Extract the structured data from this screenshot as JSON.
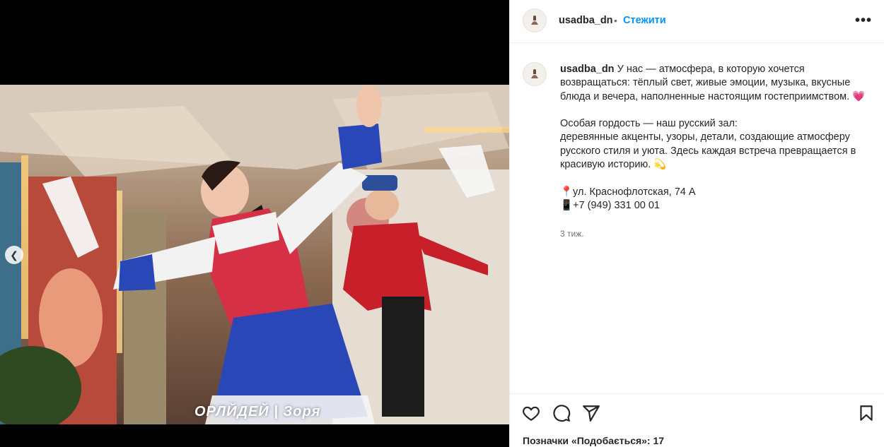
{
  "media": {
    "watermark": "ОРЛЙДЕЙ | Зоря",
    "prev_icon": "chevron-left-icon"
  },
  "header": {
    "username": "usadba_dn",
    "separator": "•",
    "follow_label": "Стежити",
    "more_icon": "more-horizontal-icon",
    "more_label": "•••"
  },
  "caption": {
    "username": "usadba_dn",
    "text": " У нас — атмосфера, в которую хочется возвращаться: тёплый свет, живые эмоции, музыка, вкусные блюда и вечера, наполненные настоящим гостеприимством. 💗\n\nОсобая гордость — наш русский зал:\nдеревянные акценты, узоры, детали, создающие атмосферу русского стиля и уюта. Здесь каждая встреча превращается в красивую историю. 💫\n\n📍ул. Краснофлотская, 74 А\n📱+7 (949) 331 00 01",
    "time": "3 тиж."
  },
  "actions": {
    "like_icon": "heart-icon",
    "comment_icon": "comment-icon",
    "share_icon": "send-icon",
    "save_icon": "bookmark-icon",
    "likes_text": "Позначки «Подобається»: 17"
  },
  "colors": {
    "accent": "#0095f6",
    "text": "#262626",
    "muted": "#737373",
    "border": "#efefef"
  }
}
